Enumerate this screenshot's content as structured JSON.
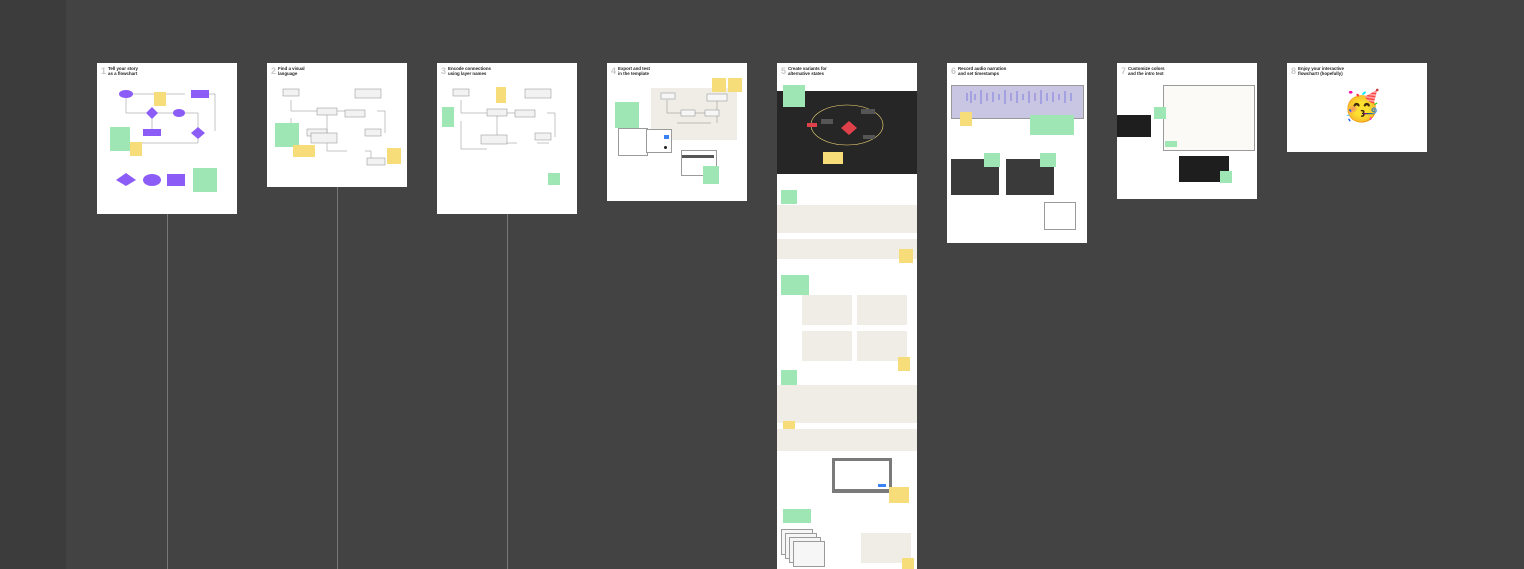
{
  "steps": [
    {
      "num": "1",
      "title": "Tell your story\nas a flowchart"
    },
    {
      "num": "2",
      "title": "Find a visual\nlanguage"
    },
    {
      "num": "3",
      "title": "Encode connections\nusing layer names"
    },
    {
      "num": "4",
      "title": "Export and test\nin the template"
    },
    {
      "num": "5",
      "title": "Create variants for\nalternative states"
    },
    {
      "num": "6",
      "title": "Record audio narration\nand set timestamps"
    },
    {
      "num": "7",
      "title": "Customize colors\nand the intro text"
    },
    {
      "num": "8",
      "title": "Enjoy your interactive\nflowchart! (hopefully)"
    }
  ],
  "icons": {
    "party_face": "🥳"
  },
  "colors": {
    "canvas": "#434343",
    "purple": "#8b5cf6",
    "sticky_yellow": "#f7dc7a",
    "sticky_green": "#9ee6b4",
    "beige": "#efede5",
    "red": "#e0404a"
  }
}
